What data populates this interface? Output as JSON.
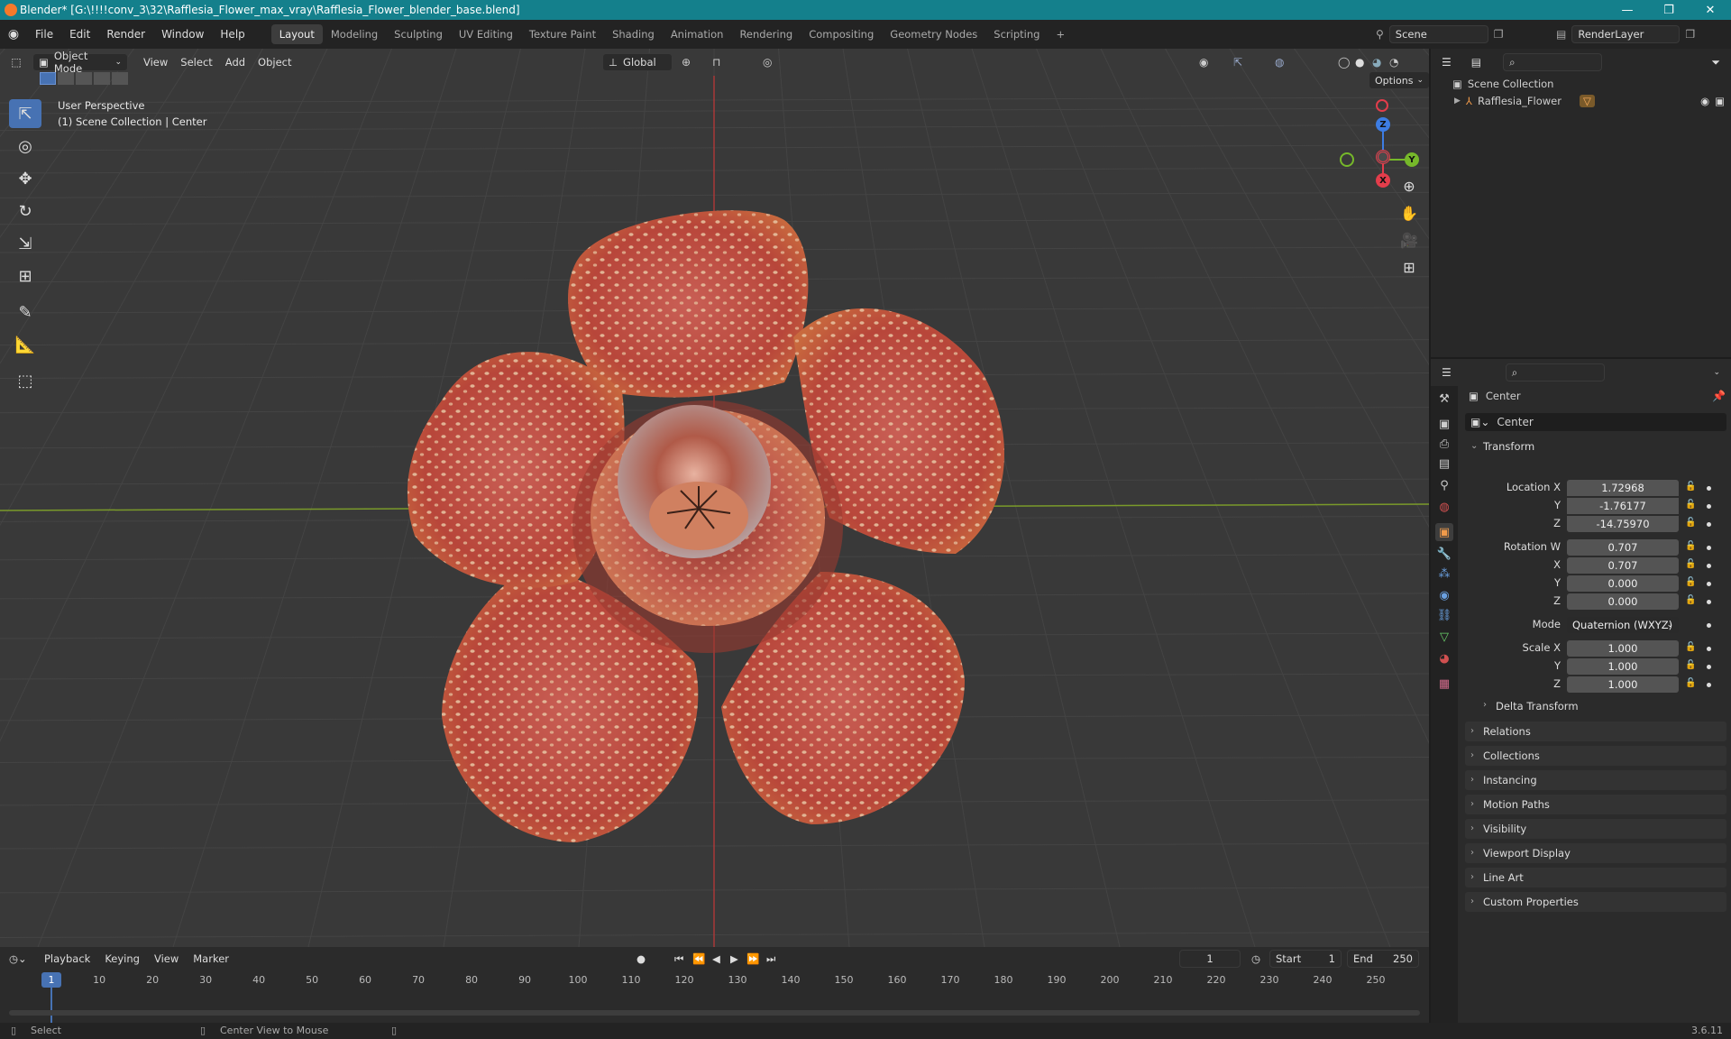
{
  "window": {
    "title": "Blender* [G:\\!!!!conv_3\\32\\Rafflesia_Flower_max_vray\\Rafflesia_Flower_blender_base.blend]",
    "controls": [
      "—",
      "❐",
      "✕"
    ]
  },
  "menubar": {
    "menus": [
      "File",
      "Edit",
      "Render",
      "Window",
      "Help"
    ],
    "workspaces": [
      "Layout",
      "Modeling",
      "Sculpting",
      "UV Editing",
      "Texture Paint",
      "Shading",
      "Animation",
      "Rendering",
      "Compositing",
      "Geometry Nodes",
      "Scripting"
    ],
    "active_workspace": "Layout",
    "add_tab": "+",
    "scene": "Scene",
    "render_layer": "RenderLayer"
  },
  "viewport": {
    "mode": "Object Mode",
    "menus": [
      "View",
      "Select",
      "Add",
      "Object"
    ],
    "orientation": "Global",
    "options": "Options",
    "overlay_line1": "User Perspective",
    "overlay_line2": "(1) Scene Collection | Center",
    "gizmo": {
      "x": "X",
      "y": "Y",
      "z": "Z"
    }
  },
  "outliner": {
    "root": "Scene Collection",
    "items": [
      {
        "name": "Rafflesia_Flower"
      }
    ]
  },
  "properties": {
    "object_name": "Center",
    "data_name": "Center",
    "transform_label": "Transform",
    "location": {
      "label": "Location X",
      "x": "1.72968",
      "y": "-1.76177",
      "z": "-14.75970"
    },
    "rotation": {
      "label": "Rotation W",
      "w": "0.707",
      "x": "0.707",
      "y": "0.000",
      "z": "0.000"
    },
    "mode": {
      "label": "Mode",
      "value": "Quaternion (WXYZ)"
    },
    "scale": {
      "label": "Scale X",
      "x": "1.000",
      "y": "1.000",
      "z": "1.000"
    },
    "axis_y": "Y",
    "axis_z": "Z",
    "axis_x": "X",
    "delta": "Delta Transform",
    "panels": [
      "Relations",
      "Collections",
      "Instancing",
      "Motion Paths",
      "Visibility",
      "Viewport Display",
      "Line Art",
      "Custom Properties"
    ]
  },
  "timeline": {
    "menus": [
      "Playback",
      "Keying",
      "View",
      "Marker"
    ],
    "current_frame": "1",
    "start_label": "Start",
    "start": "1",
    "end_label": "End",
    "end": "250",
    "ticks": [
      "1",
      "10",
      "20",
      "30",
      "40",
      "50",
      "60",
      "70",
      "80",
      "90",
      "100",
      "110",
      "120",
      "130",
      "140",
      "150",
      "160",
      "170",
      "180",
      "190",
      "200",
      "210",
      "220",
      "230",
      "240",
      "250"
    ]
  },
  "statusbar": {
    "select": "Select",
    "center": "Center View to Mouse",
    "version": "3.6.11"
  }
}
